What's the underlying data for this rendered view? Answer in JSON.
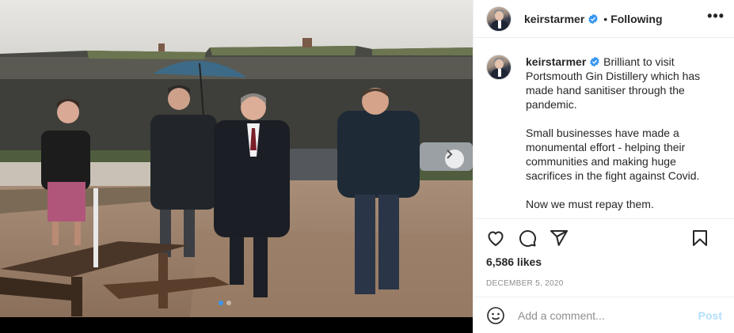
{
  "post": {
    "username": "keirstarmer",
    "verified": true,
    "follow_status": "Following",
    "separator": "•",
    "more_icon": "more-horizontal-icon"
  },
  "caption": {
    "username": "keirstarmer",
    "paragraphs": [
      "Brilliant to visit Portsmouth Gin Distillery which has made hand sanitiser through the pandemic.",
      "Small businesses have made a monumental effort - helping their communities and making huge sacrifices in the fight against Covid.",
      "Now we must repay them."
    ]
  },
  "engagement": {
    "likes": "6,586 likes",
    "date": "DECEMBER 5, 2020"
  },
  "comment": {
    "placeholder": "Add a comment...",
    "post_label": "Post"
  },
  "carousel": {
    "total_slides": 2,
    "active_slide": 1
  },
  "colors": {
    "accent": "#3897f0",
    "post_disabled": "#b2dffc",
    "verified": "#3897f0"
  }
}
